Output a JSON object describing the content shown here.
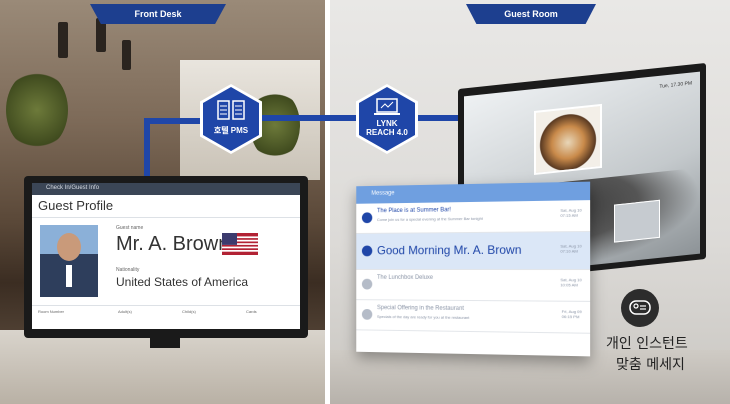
{
  "sections": {
    "front_desk": "Front Desk",
    "guest_room": "Guest Room"
  },
  "connectors": {
    "pms_label": "호텔 PMS",
    "lynk_label_1": "LYNK",
    "lynk_label_2": "REACH 4.0"
  },
  "guest_profile": {
    "header": "Check In/Guest Info",
    "title": "Guest Profile",
    "name_label": "Guest name",
    "name": "Mr. A. Brown",
    "nationality_label": "Nationality",
    "nationality": "United States of America",
    "footer_cols": [
      "Room Number",
      "Adult(s)",
      "Child(s)",
      "Cards"
    ]
  },
  "tv": {
    "corner_text": "Tue, 17.30 PM"
  },
  "messages": {
    "header": "Message",
    "items": [
      {
        "title": "The Place is at Summer Bar!",
        "sub": "Come join us for a special evening at the Summer Bar tonight",
        "date1": "Sat, Aug 10",
        "date2": "07:15 AM",
        "highlight": false,
        "color": "#1f46a8"
      },
      {
        "title": "Good Morning Mr. A. Brown",
        "sub": "",
        "date1": "Sat, Aug 10",
        "date2": "07:10 AM",
        "highlight": true,
        "color": "#1f46a8"
      },
      {
        "title": "The Lunchbox Deluxe",
        "sub": "",
        "date1": "Sat, Aug 10",
        "date2": "10:05 AM",
        "highlight": false,
        "color": "#b5bcc8"
      },
      {
        "title": "Special Offering in the Restaurant",
        "sub": "Specials of the day are ready for you at the restaurant",
        "date1": "Fri, Aug 09",
        "date2": "06:15 PM",
        "highlight": false,
        "color": "#b5bcc8"
      }
    ]
  },
  "caption": {
    "line1": "개인 인스턴트",
    "line2": "맞춤 메세지"
  },
  "icons": [
    "server-icon",
    "laptop-icon",
    "flag-icon",
    "chat-bubble-icon",
    "arrow-right-icon"
  ],
  "colors": {
    "accent": "#1f46a8"
  }
}
